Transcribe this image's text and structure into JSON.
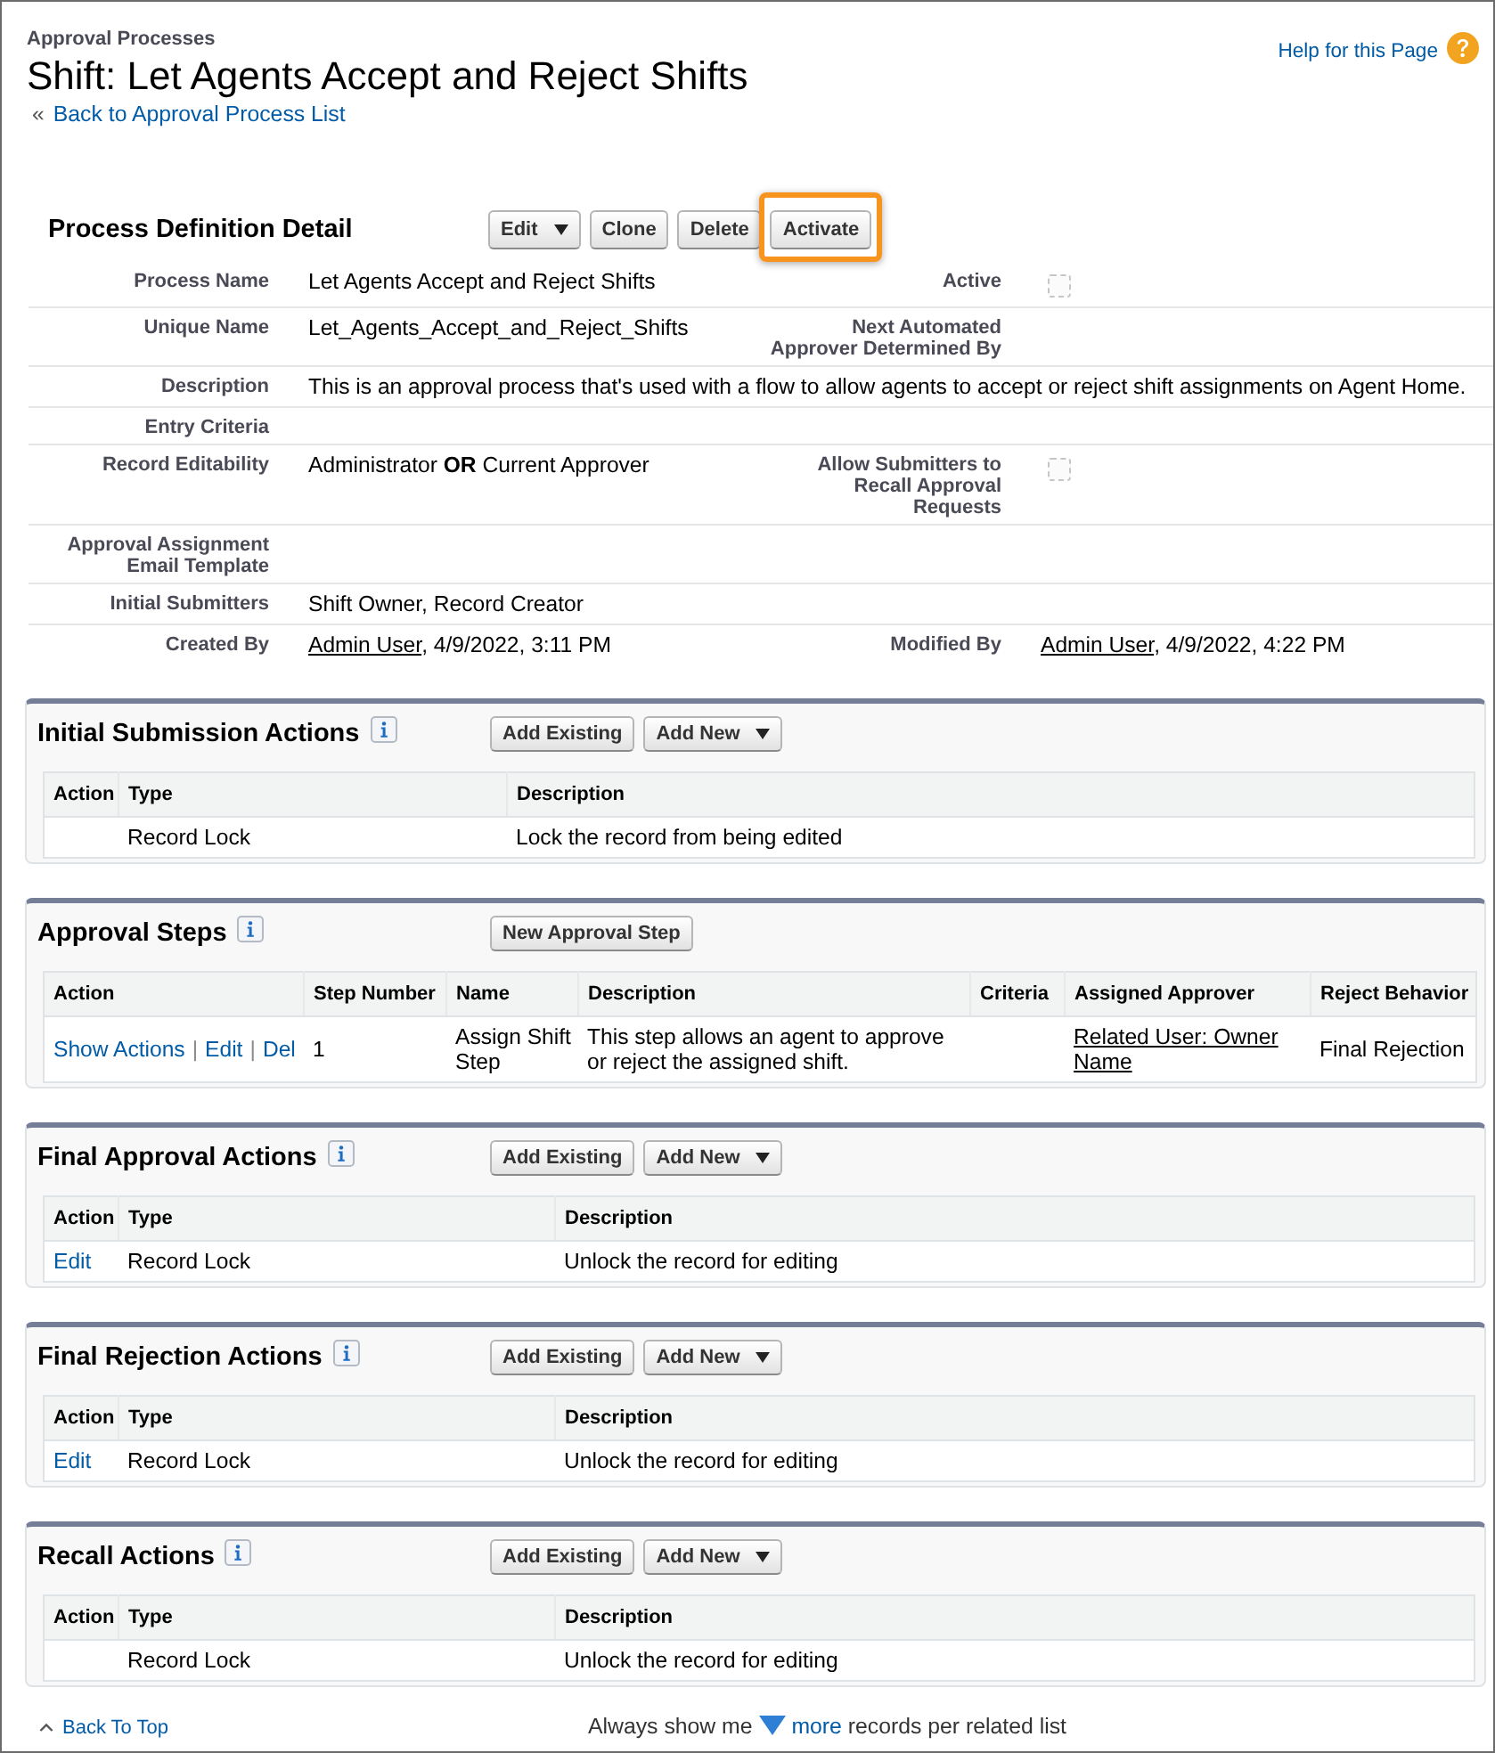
{
  "header": {
    "breadcrumb": "Approval Processes",
    "title": "Shift: Let Agents Accept and Reject Shifts",
    "back_marker": "«",
    "back_link": "Back to Approval Process List",
    "help_link": "Help for this Page"
  },
  "detail": {
    "title": "Process Definition Detail",
    "buttons": [
      {
        "label": "Edit",
        "dropdown": true,
        "highlighted": false
      },
      {
        "label": "Clone",
        "dropdown": false,
        "highlighted": false
      },
      {
        "label": "Delete",
        "dropdown": false,
        "highlighted": false
      },
      {
        "label": "Activate",
        "dropdown": false,
        "highlighted": true
      }
    ],
    "rows": [
      {
        "fields": [
          {
            "label": "Process Name",
            "kind": "text",
            "value": "Let Agents Accept and Reject Shifts"
          },
          {
            "label": "Active",
            "kind": "checkbox",
            "checked": false
          }
        ]
      },
      {
        "fields": [
          {
            "label": "Unique Name",
            "kind": "text",
            "value": "Let_Agents_Accept_and_Reject_Shifts"
          },
          {
            "label": "Next Automated Approver Determined By",
            "kind": "text"
          }
        ]
      },
      {
        "fields": [
          {
            "label": "Description",
            "kind": "text",
            "value": "This is an approval process that's used with a flow to allow agents to accept or reject shift assignments on Agent Home."
          }
        ]
      },
      {
        "fields": [
          {
            "label": "Entry Criteria",
            "kind": "text"
          }
        ]
      },
      {
        "fields": [
          {
            "label": "Record Editability",
            "kind": "text",
            "value": "Administrator **OR** Current Approver"
          },
          {
            "label": "Allow Submitters to Recall Approval Requests",
            "kind": "checkbox",
            "checked": false
          }
        ]
      },
      {
        "fields": [
          {
            "label": "Approval Assignment Email Template",
            "kind": "text"
          }
        ]
      },
      {
        "fields": [
          {
            "label": "Initial Submitters",
            "kind": "text",
            "value": "Shift Owner, Record Creator"
          }
        ]
      },
      {
        "fields": [
          {
            "label": "Created By",
            "kind": "user",
            "link": "Admin User",
            "value": ", 4/9/2022, 3:11 PM"
          },
          {
            "label": "Modified By",
            "kind": "user",
            "link": "Admin User",
            "value": ", 4/9/2022, 4:22 PM"
          }
        ]
      }
    ]
  },
  "sections": [
    {
      "kind": "actions",
      "title": "Initial Submission Actions",
      "buttons": [
        {
          "label": "Add Existing",
          "dropdown": false
        },
        {
          "label": "Add New",
          "dropdown": true
        }
      ],
      "columns": [
        "Action",
        "Type",
        "Description"
      ],
      "rows": [
        {
          "cells": [
            "",
            {
              "kind": "text",
              "text": "Record Lock"
            },
            {
              "kind": "text",
              "text": "Lock the record from being edited"
            }
          ]
        }
      ]
    },
    {
      "kind": "steps",
      "title": "Approval Steps",
      "buttons": [
        {
          "label": "New Approval Step",
          "dropdown": false
        }
      ],
      "columns": [
        "Action",
        "Step Number",
        "Name",
        "Description",
        "Criteria",
        "Assigned Approver",
        "Reject Behavior"
      ],
      "rows": [
        {
          "cells": [
            {
              "kind": "actions",
              "items": [
                {
                  "kind": "link",
                  "text": "Show Actions"
                },
                {
                  "kind": "separator",
                  "text": "|"
                },
                {
                  "kind": "link",
                  "text": "Edit"
                },
                {
                  "kind": "separator",
                  "text": "|"
                },
                {
                  "kind": "link",
                  "text": "Del"
                }
              ]
            },
            {
              "kind": "text",
              "text": "1"
            },
            {
              "kind": "text",
              "text": "Assign Shift Step"
            },
            {
              "kind": "text",
              "text": "This step allows an agent to approve or reject the assigned shift."
            },
            "",
            {
              "kind": "user_link",
              "text": "Related User: Owner Name"
            },
            {
              "kind": "text",
              "text": "Final Rejection"
            }
          ]
        }
      ]
    },
    {
      "kind": "actions",
      "title": "Final Approval Actions",
      "buttons": [
        {
          "label": "Add Existing",
          "dropdown": false
        },
        {
          "label": "Add New",
          "dropdown": true
        }
      ],
      "columns": [
        "Action",
        "Type",
        "Description"
      ],
      "rows": [
        {
          "cells": [
            {
              "kind": "actions",
              "items": [
                {
                  "kind": "link",
                  "text": "Edit"
                }
              ]
            },
            {
              "kind": "text",
              "text": "Record Lock"
            },
            {
              "kind": "text",
              "text": "Unlock the record for editing"
            }
          ]
        }
      ]
    },
    {
      "kind": "actions",
      "title": "Final Rejection Actions",
      "buttons": [
        {
          "label": "Add Existing",
          "dropdown": false
        },
        {
          "label": "Add New",
          "dropdown": true
        }
      ],
      "columns": [
        "Action",
        "Type",
        "Description"
      ],
      "rows": [
        {
          "cells": [
            {
              "kind": "actions",
              "items": [
                {
                  "kind": "link",
                  "text": "Edit"
                }
              ]
            },
            {
              "kind": "text",
              "text": "Record Lock"
            },
            {
              "kind": "text",
              "text": "Unlock the record for editing"
            }
          ]
        }
      ]
    },
    {
      "kind": "actions",
      "title": "Recall Actions",
      "buttons": [
        {
          "label": "Add Existing",
          "dropdown": false
        },
        {
          "label": "Add New",
          "dropdown": true
        }
      ],
      "columns": [
        "Action",
        "Type",
        "Description"
      ],
      "rows": [
        {
          "cells": [
            "",
            {
              "kind": "text",
              "text": "Record Lock"
            },
            {
              "kind": "text",
              "text": "Unlock the record for editing"
            }
          ]
        }
      ]
    }
  ],
  "footer": {
    "back_to_top": "Back To Top",
    "prefix": "Always show me",
    "more_link": "more",
    "suffix": "records per related list"
  }
}
